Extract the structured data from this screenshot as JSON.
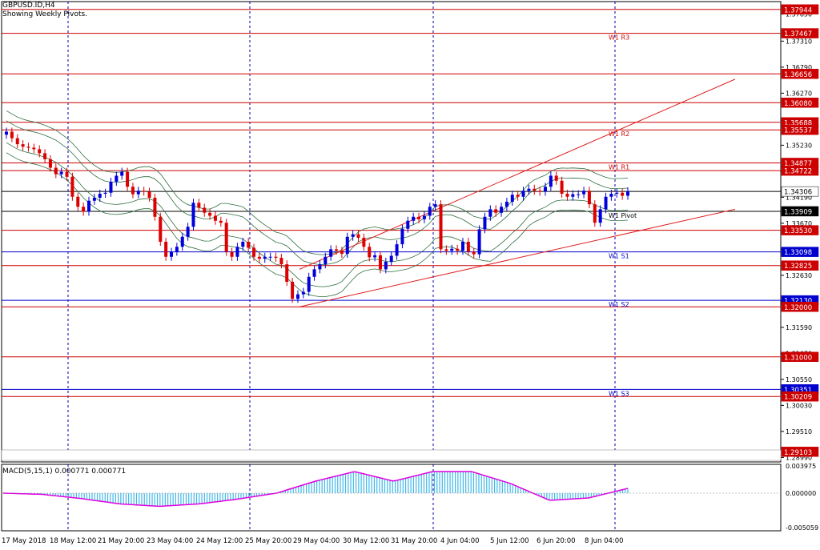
{
  "header": {
    "symbol": "GBPUSD.ID,H4",
    "subtitle": "Showing Weekly Pivots."
  },
  "macd_label": "MACD(5,15,1) 0.000771 0.000771",
  "colors": {
    "background": "#ffffff",
    "frame": "#000000",
    "bull_candle": "#0000dd",
    "bear_candle": "#dd0000",
    "resistance_line": "#cc0000",
    "support_line": "#0000cc",
    "pivot_line": "#000000",
    "bollinger": "#2f6f3f",
    "trend_channel": "#e02020",
    "macd_hist": "#40b8e8",
    "macd_signal": "#e000e0",
    "fractal_arrow": "#3399ff",
    "label_red_bg": "#cc0000",
    "label_blue_bg": "#0000cc",
    "label_current_bg": "#000080",
    "grid": "#0000aa"
  },
  "chart_data": {
    "type": "candlestick",
    "symbol": "GBPUSD.ID",
    "timeframe": "H4",
    "ylim": [
      1.289,
      1.381
    ],
    "price_axis_ticks": [
      "1.37850",
      "1.37310",
      "1.36790",
      "1.36270",
      "1.35730",
      "1.35230",
      "1.34710",
      "1.34190",
      "1.33670",
      "1.33150",
      "1.32630",
      "1.32110",
      "1.31590",
      "1.31070",
      "1.30550",
      "1.30030",
      "1.29510",
      "1.28990"
    ],
    "x_axis_labels": [
      "17 May 2018",
      "18 May 12:00",
      "21 May 20:00",
      "23 May 04:00",
      "24 May 12:00",
      "25 May 20:00",
      "29 May 04:00",
      "30 May 12:00",
      "31 May 20:00",
      "4 Jun 04:00",
      "5 Jun 12:00",
      "6 Jun 20:00",
      "8 Jun 04:00"
    ],
    "current_price": 1.34306,
    "pivot_levels": [
      {
        "label": "W1 R3",
        "price": 1.37467,
        "kind": "resistance"
      },
      {
        "label": "W1 R2",
        "price": 1.35537,
        "kind": "resistance"
      },
      {
        "label": "W1 R1",
        "price": 1.34877,
        "kind": "resistance"
      },
      {
        "label": "W1 Pivot",
        "price": 1.33909,
        "kind": "pivot"
      },
      {
        "label": "W1 S1",
        "price": 1.33098,
        "kind": "support"
      },
      {
        "label": "W1 S2",
        "price": 1.3213,
        "kind": "support"
      },
      {
        "label": "W1 S3",
        "price": 1.30351,
        "kind": "support"
      }
    ],
    "axis_price_labels": [
      {
        "price": 1.37944,
        "kind": "resistance"
      },
      {
        "price": 1.37467,
        "kind": "resistance"
      },
      {
        "price": 1.36656,
        "kind": "resistance"
      },
      {
        "price": 1.3608,
        "kind": "resistance"
      },
      {
        "price": 1.35688,
        "kind": "resistance"
      },
      {
        "price": 1.35537,
        "kind": "resistance"
      },
      {
        "price": 1.34877,
        "kind": "resistance"
      },
      {
        "price": 1.34722,
        "kind": "resistance"
      },
      {
        "price": 1.34306,
        "kind": "current"
      },
      {
        "price": 1.33909,
        "kind": "pivot"
      },
      {
        "price": 1.3353,
        "kind": "resistance"
      },
      {
        "price": 1.33098,
        "kind": "support"
      },
      {
        "price": 1.32825,
        "kind": "resistance"
      },
      {
        "price": 1.3213,
        "kind": "support"
      },
      {
        "price": 1.32,
        "kind": "resistance"
      },
      {
        "price": 1.31,
        "kind": "resistance"
      },
      {
        "price": 1.30351,
        "kind": "support"
      },
      {
        "price": 1.30209,
        "kind": "resistance"
      },
      {
        "price": 1.29103,
        "kind": "resistance"
      }
    ],
    "candles_close": [
      1.355,
      1.3537,
      1.3525,
      1.352,
      1.3518,
      1.3515,
      1.3507,
      1.3495,
      1.3478,
      1.3465,
      1.347,
      1.346,
      1.342,
      1.34,
      1.339,
      1.3412,
      1.3418,
      1.3426,
      1.3428,
      1.345,
      1.3462,
      1.347,
      1.344,
      1.3425,
      1.3432,
      1.343,
      1.3418,
      1.338,
      1.333,
      1.33,
      1.331,
      1.332,
      1.334,
      1.336,
      1.3408,
      1.3398,
      1.3388,
      1.3382,
      1.3372,
      1.3368,
      1.331,
      1.33,
      1.332,
      1.333,
      1.3318,
      1.33,
      1.3296,
      1.33,
      1.33,
      1.3298,
      1.3285,
      1.325,
      1.3216,
      1.3225,
      1.323,
      1.326,
      1.3275,
      1.3285,
      1.33,
      1.3315,
      1.3312,
      1.3306,
      1.334,
      1.3345,
      1.3338,
      1.332,
      1.3299,
      1.3303,
      1.3275,
      1.329,
      1.3302,
      1.3325,
      1.3356,
      1.3372,
      1.338,
      1.3375,
      1.3382,
      1.34,
      1.3405,
      1.3315,
      1.3312,
      1.3316,
      1.3312,
      1.333,
      1.331,
      1.3305,
      1.3355,
      1.338,
      1.3395,
      1.3388,
      1.34,
      1.341,
      1.3424,
      1.342,
      1.3432,
      1.3436,
      1.3432,
      1.343,
      1.344,
      1.3462,
      1.3452,
      1.3426,
      1.342,
      1.3425,
      1.3425,
      1.3432,
      1.3405,
      1.3368,
      1.3395,
      1.342,
      1.3426,
      1.3428,
      1.3422,
      1.3431
    ],
    "macd_hist_values": [
      0.0,
      -0.0002,
      -0.0009,
      -0.0018,
      -0.0022,
      -0.0018,
      -0.001,
      0.0,
      0.002,
      0.0036,
      0.002,
      0.0036,
      0.0036,
      0.0016,
      -0.0012,
      -0.0008,
      0.0008
    ]
  }
}
